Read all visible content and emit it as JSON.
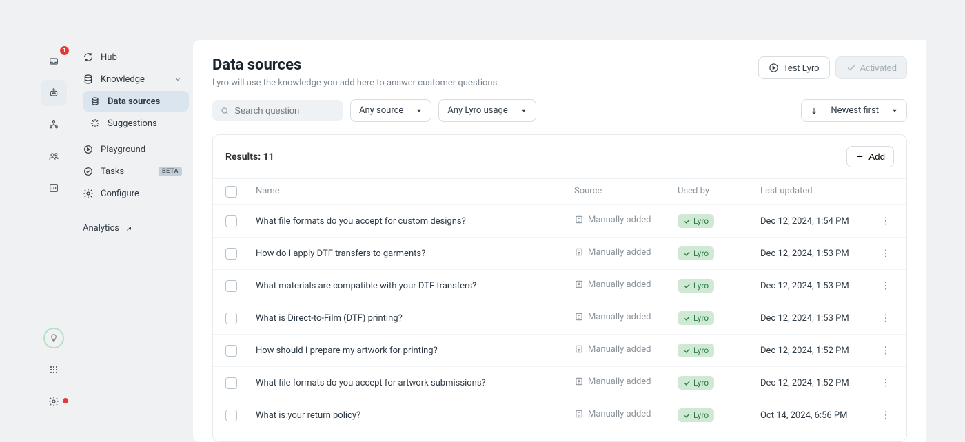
{
  "iconbar": {
    "badge_count": "1"
  },
  "subnav": {
    "hub": "Hub",
    "knowledge": "Knowledge",
    "data_sources": "Data sources",
    "suggestions": "Suggestions",
    "playground": "Playground",
    "tasks": "Tasks",
    "tasks_badge": "BETA",
    "configure": "Configure",
    "analytics": "Analytics"
  },
  "page": {
    "title": "Data sources",
    "subtitle": "Lyro will use the knowledge you add here to answer customer questions.",
    "test_btn": "Test Lyro",
    "activated_btn": "Activated"
  },
  "filters": {
    "search_placeholder": "Search question",
    "source_dd": "Any source",
    "usage_dd": "Any Lyro usage",
    "sort_dd": "Newest first"
  },
  "results": {
    "label": "Results:",
    "count": "11",
    "add_btn": "Add",
    "columns": {
      "name": "Name",
      "source": "Source",
      "used_by": "Used by",
      "updated": "Last updated"
    },
    "rows": [
      {
        "name": "What file formats do you accept for custom designs?",
        "source": "Manually added",
        "used_by": "Lyro",
        "updated": "Dec 12, 2024, 1:54 PM"
      },
      {
        "name": "How do I apply DTF transfers to garments?",
        "source": "Manually added",
        "used_by": "Lyro",
        "updated": "Dec 12, 2024, 1:53 PM"
      },
      {
        "name": "What materials are compatible with your DTF transfers?",
        "source": "Manually added",
        "used_by": "Lyro",
        "updated": "Dec 12, 2024, 1:53 PM"
      },
      {
        "name": "What is Direct-to-Film (DTF) printing?",
        "source": "Manually added",
        "used_by": "Lyro",
        "updated": "Dec 12, 2024, 1:53 PM"
      },
      {
        "name": "How should I prepare my artwork for printing?",
        "source": "Manually added",
        "used_by": "Lyro",
        "updated": "Dec 12, 2024, 1:52 PM"
      },
      {
        "name": "What file formats do you accept for artwork submissions?",
        "source": "Manually added",
        "used_by": "Lyro",
        "updated": "Dec 12, 2024, 1:52 PM"
      },
      {
        "name": "What is your return policy?",
        "source": "Manually added",
        "used_by": "Lyro",
        "updated": "Oct 14, 2024, 6:56 PM"
      }
    ]
  }
}
